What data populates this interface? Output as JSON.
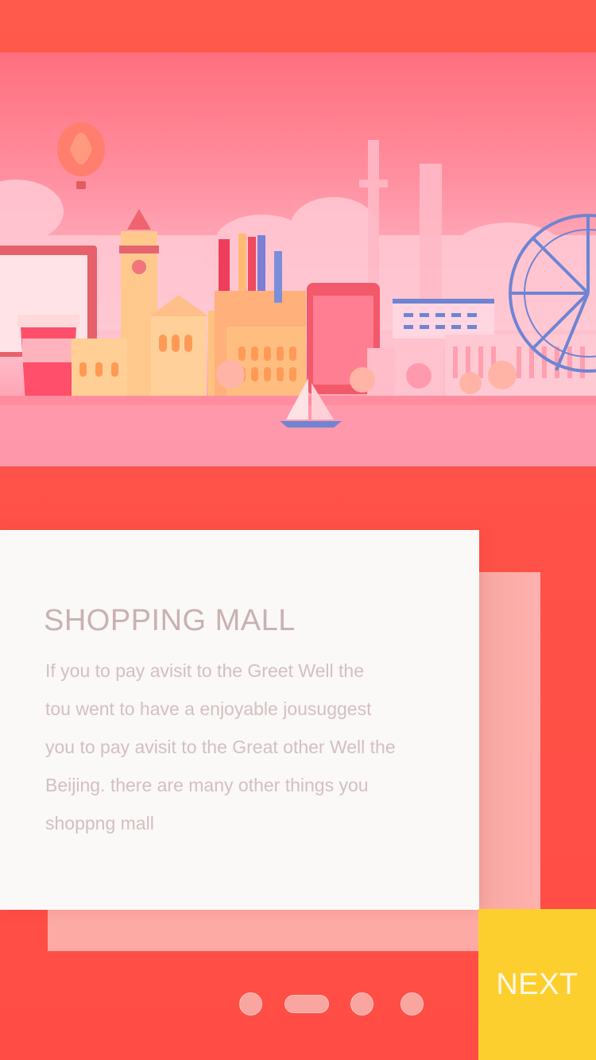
{
  "onboarding": {
    "title": "SHOPPING MALL",
    "description_lines": [
      "If you to pay avisit to the Greet Well the",
      "tou went to have a enjoyable jousuggest",
      "you to pay avisit to the Great other Well the",
      "Beijing. there are many other things you",
      "shoppng mall"
    ],
    "next_label": "NEXT",
    "pagination": {
      "count": 4,
      "active_index": 1
    }
  },
  "banner": {
    "illustration": "city-skyline-illustration"
  },
  "colors": {
    "background": "#ff5047",
    "card": "#faf9f7",
    "next_button": "#fdcf2e",
    "title_text": "#c9b1b3",
    "body_text": "#d4bfc1",
    "dot": "#f9a5a0"
  }
}
